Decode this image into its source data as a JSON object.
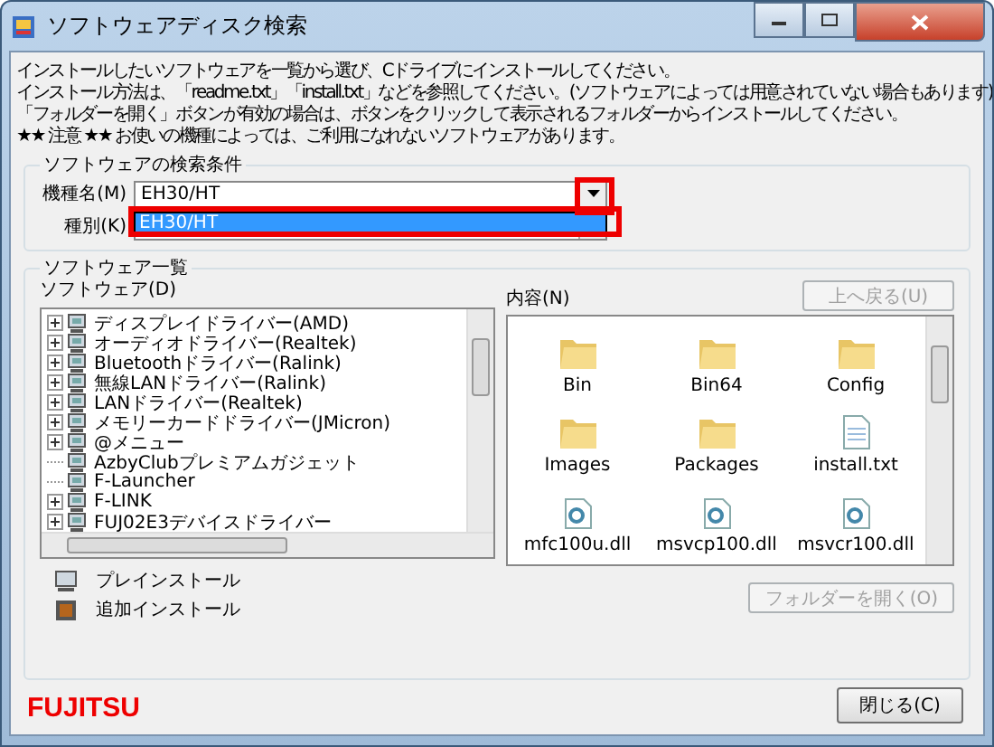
{
  "window": {
    "title": "ソフトウェアディスク検索"
  },
  "instructions": [
    "インストールしたいソフトウェアを一覧から選び、Cドライブにインストールしてください。",
    "インストール方法は、「readme.txt」「install.txt」などを参照してください。(ソフトウェアによっては用意されていない場合もあります)",
    "「フォルダーを開く」ボタンが有効の場合は、ボタンをクリックして表示されるフォルダーからインストールしてください。",
    "★★ 注意 ★★ お使いの機種によっては、ご利用になれないソフトウェアがあります。"
  ],
  "search": {
    "title": "ソフトウェアの検索条件",
    "model_label": "機種名(M)",
    "model_value": "EH30/HT",
    "model_options": [
      {
        "label": "EH30/HT",
        "selected": true
      }
    ],
    "type_label": "種別(K)",
    "highlighted": true
  },
  "list": {
    "title": "ソフトウェア一覧",
    "software_label": "ソフトウェア(D)",
    "content_label": "内容(N)",
    "up_button": {
      "label": "上へ戻る(U)",
      "disabled": true
    },
    "tree": [
      {
        "label": "ディスプレイドライバー(AMD)",
        "expandable": true
      },
      {
        "label": "オーディオドライバー(Realtek)",
        "expandable": true
      },
      {
        "label": "Bluetoothドライバー(Ralink)",
        "expandable": true
      },
      {
        "label": "無線LANドライバー(Ralink)",
        "expandable": true
      },
      {
        "label": "LANドライバー(Realtek)",
        "expandable": true
      },
      {
        "label": "メモリーカードドライバー(JMicron)",
        "expandable": true
      },
      {
        "label": "@メニュー",
        "expandable": true
      },
      {
        "label": "AzbyClubプレミアムガジェット",
        "expandable": false
      },
      {
        "label": "F-Launcher",
        "expandable": false
      },
      {
        "label": "F-LINK",
        "expandable": true
      },
      {
        "label": "FUJ02E3デバイスドライバー",
        "expandable": true
      }
    ],
    "files": [
      {
        "name": "Bin",
        "kind": "folder"
      },
      {
        "name": "Bin64",
        "kind": "folder"
      },
      {
        "name": "Config",
        "kind": "folder"
      },
      {
        "name": "Images",
        "kind": "folder"
      },
      {
        "name": "Packages",
        "kind": "folder"
      },
      {
        "name": "install.txt",
        "kind": "text"
      },
      {
        "name": "mfc100u.dll",
        "kind": "dll"
      },
      {
        "name": "msvcp100.dll",
        "kind": "dll"
      },
      {
        "name": "msvcr100.dll",
        "kind": "dll"
      }
    ],
    "legend": [
      {
        "label": "プレインストール",
        "kind": "preinstall"
      },
      {
        "label": "追加インストール",
        "kind": "additional"
      }
    ],
    "open_button": {
      "label": "フォルダーを開く(O)",
      "disabled": true
    }
  },
  "brand": "FUJITSU",
  "close_button": {
    "label": "閉じる(C)",
    "disabled": false
  }
}
